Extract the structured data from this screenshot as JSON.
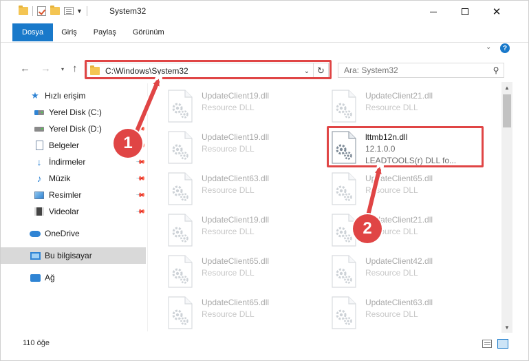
{
  "window": {
    "title": "System32",
    "minimize": "—",
    "close": "✕"
  },
  "ribbon": {
    "tabs": [
      {
        "label": "Dosya"
      },
      {
        "label": "Giriş"
      },
      {
        "label": "Paylaş"
      },
      {
        "label": "Görünüm"
      }
    ],
    "help": "?"
  },
  "nav": {
    "back": "←",
    "forward": "→",
    "recent": "▾",
    "up": "↑",
    "address": "C:\\Windows\\System32",
    "address_dropdown": "⌄",
    "refresh": "↻",
    "search_placeholder": "Ara: System32"
  },
  "sidebar": {
    "items": [
      {
        "label": "Hızlı erişim",
        "icon": "star-icon"
      },
      {
        "label": "Yerel Disk (C:)",
        "icon": "drive-icon"
      },
      {
        "label": "Yerel Disk (D:)",
        "icon": "drive-icon"
      },
      {
        "label": "Belgeler",
        "icon": "documents-icon"
      },
      {
        "label": "İndirmeler",
        "icon": "download-icon"
      },
      {
        "label": "Müzik",
        "icon": "music-icon"
      },
      {
        "label": "Resimler",
        "icon": "pictures-icon"
      },
      {
        "label": "Videolar",
        "icon": "videos-icon"
      },
      {
        "label": "OneDrive",
        "icon": "cloud-icon"
      },
      {
        "label": "Bu bilgisayar",
        "icon": "computer-icon"
      },
      {
        "label": "Ağ",
        "icon": "network-icon"
      }
    ]
  },
  "files": [
    {
      "name": "UpdateClient19.dll",
      "desc": "Resource DLL"
    },
    {
      "name": "UpdateClient21.dll",
      "desc": "Resource DLL"
    },
    {
      "name": "UpdateClient19.dll",
      "desc": "Resource DLL"
    },
    {
      "name": "lttmb12n.dll",
      "version": "12.1.0.0",
      "desc": "LEADTOOLS(r) DLL fo..."
    },
    {
      "name": "UpdateClient63.dll",
      "desc": "Resource DLL"
    },
    {
      "name": "UpdateClient65.dll",
      "desc": "Resource DLL"
    },
    {
      "name": "UpdateClient19.dll",
      "desc": "Resource DLL"
    },
    {
      "name": "UpdateClient21.dll",
      "desc": "Resource DLL"
    },
    {
      "name": "UpdateClient65.dll",
      "desc": "Resource DLL"
    },
    {
      "name": "UpdateClient42.dll",
      "desc": "Resource DLL"
    },
    {
      "name": "UpdateClient65.dll",
      "desc": "Resource DLL"
    },
    {
      "name": "UpdateClient63.dll",
      "desc": "Resource DLL"
    }
  ],
  "status": {
    "item_count": "110 öğe"
  },
  "callouts": {
    "one": "1",
    "two": "2"
  },
  "colors": {
    "accent": "#1979ca",
    "highlight": "#e04545"
  }
}
